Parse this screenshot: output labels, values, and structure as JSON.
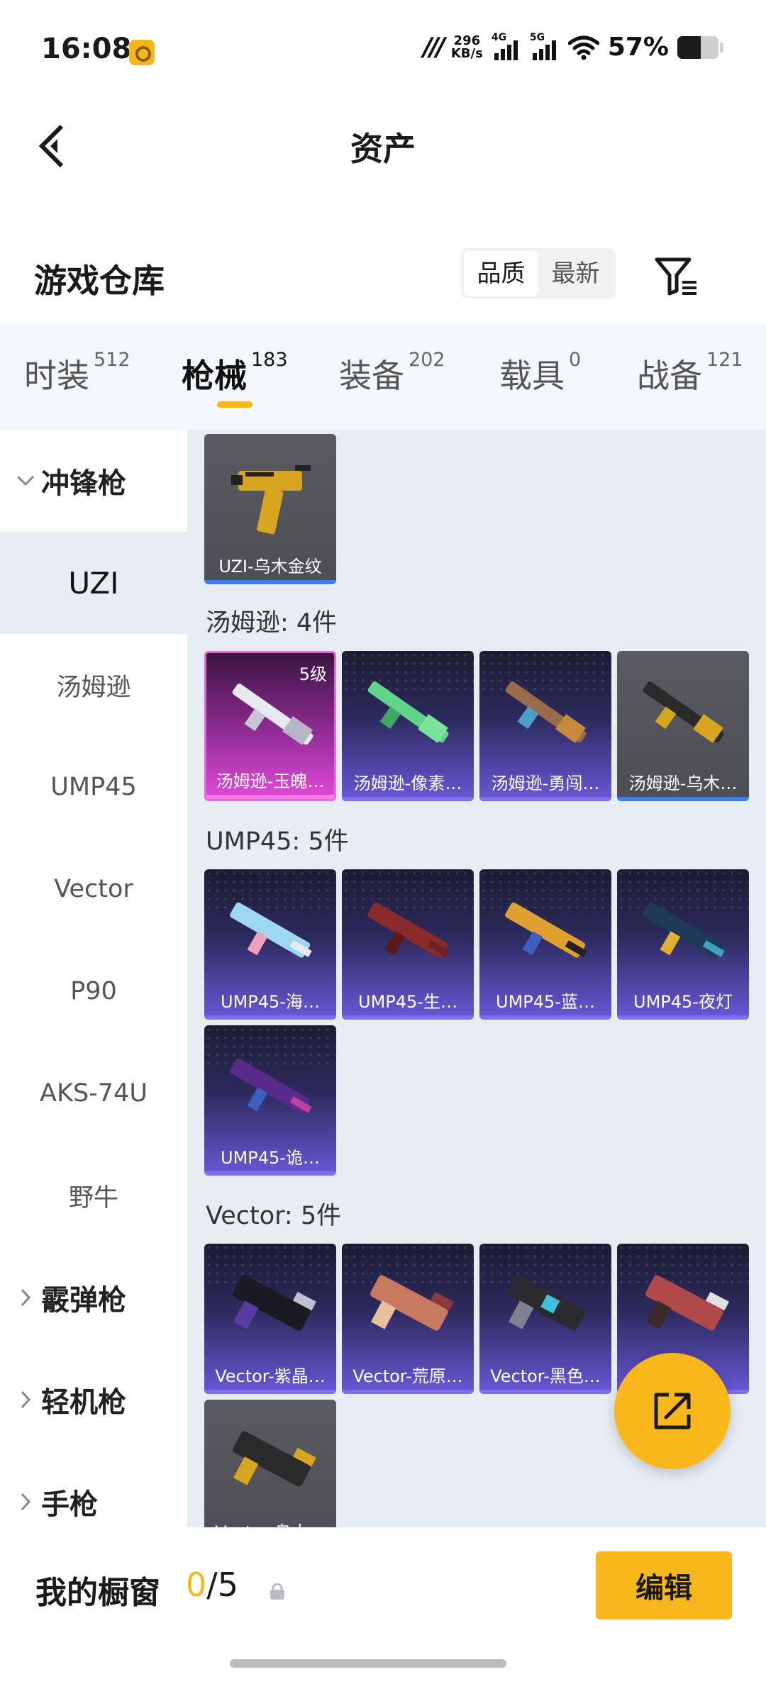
{
  "status_bar": {
    "time": "16:08",
    "speed_value": "296",
    "speed_unit": "KB/s",
    "net1": "4G",
    "net2": "5G",
    "battery": "57%",
    "battery_level": 0.57
  },
  "header": {
    "title": "资产"
  },
  "warehouse": {
    "title": "游戏仓库",
    "sort_options": [
      "品质",
      "最新"
    ],
    "sort_active": "品质"
  },
  "tabs": [
    {
      "label": "时装",
      "count": "512"
    },
    {
      "label": "枪械",
      "count": "183"
    },
    {
      "label": "装备",
      "count": "202"
    },
    {
      "label": "载具",
      "count": "0"
    },
    {
      "label": "战备",
      "count": "121"
    }
  ],
  "active_tab": "枪械",
  "categories": {
    "smg": "冲锋枪",
    "subs": [
      "UZI",
      "汤姆逊",
      "UMP45",
      "Vector",
      "P90",
      "AKS-74U",
      "野牛"
    ],
    "shotgun": "霰弹枪",
    "lmg": "轻机枪",
    "pistol": "手枪"
  },
  "sections": {
    "thompson": "汤姆逊: 4件",
    "ump": "UMP45: 5件",
    "vector": "Vector: 5件"
  },
  "items": {
    "uzi": [
      "UZI-乌木金纹"
    ],
    "thompson": [
      "汤姆逊-玉魄…",
      "汤姆逊-像素…",
      "汤姆逊-勇闯…",
      "汤姆逊-乌木…"
    ],
    "thompson_badge": "5级",
    "ump": [
      "UMP45-海…",
      "UMP45-生…",
      "UMP45-蓝…",
      "UMP45-夜灯",
      "UMP45-诡…"
    ],
    "vector": [
      "Vector-紫晶…",
      "Vector-荒原…",
      "Vector-黑色…",
      "Vector-…",
      "Vector-乌木…"
    ]
  },
  "showcase": {
    "title": "我的橱窗",
    "current": "0",
    "total": "/5",
    "edit_label": "编辑"
  },
  "colors": {
    "accent": "#f8b81c",
    "rare_purple": "#6a58d8",
    "legend_pink": "#e04ad8",
    "common_gray": "#4d4e53"
  }
}
